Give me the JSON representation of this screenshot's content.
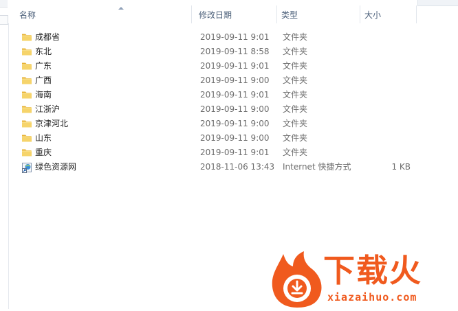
{
  "columns": {
    "name": "名称",
    "date": "修改日期",
    "type": "类型",
    "size": "大小"
  },
  "files": [
    {
      "name": "成都省",
      "date": "2019-09-11 9:01",
      "type": "文件夹",
      "size": "",
      "icon": "folder-icon"
    },
    {
      "name": "东北",
      "date": "2019-09-11 8:58",
      "type": "文件夹",
      "size": "",
      "icon": "folder-icon"
    },
    {
      "name": "广东",
      "date": "2019-09-11 9:01",
      "type": "文件夹",
      "size": "",
      "icon": "folder-icon"
    },
    {
      "name": "广西",
      "date": "2019-09-11 9:00",
      "type": "文件夹",
      "size": "",
      "icon": "folder-icon"
    },
    {
      "name": "海南",
      "date": "2019-09-11 9:01",
      "type": "文件夹",
      "size": "",
      "icon": "folder-icon"
    },
    {
      "name": "江浙沪",
      "date": "2019-09-11 9:00",
      "type": "文件夹",
      "size": "",
      "icon": "folder-icon"
    },
    {
      "name": "京津河北",
      "date": "2019-09-11 9:00",
      "type": "文件夹",
      "size": "",
      "icon": "folder-icon"
    },
    {
      "name": "山东",
      "date": "2019-09-11 9:00",
      "type": "文件夹",
      "size": "",
      "icon": "folder-icon"
    },
    {
      "name": "重庆",
      "date": "2019-09-11 9:01",
      "type": "文件夹",
      "size": "",
      "icon": "folder-icon"
    },
    {
      "name": "绿色资源网",
      "date": "2018-11-06 13:43",
      "type": "Internet 快捷方式",
      "size": "1 KB",
      "icon": "internet-shortcut-icon"
    }
  ],
  "watermark": {
    "brand": "下载火",
    "url": "xiazaihuo.com",
    "color": "#f05a1e",
    "icon": "flame-logo-icon"
  },
  "colors": {
    "header_text": "#4c607a",
    "folder_yellow": "#f2c24a",
    "detail_text": "#6d6d6d"
  }
}
